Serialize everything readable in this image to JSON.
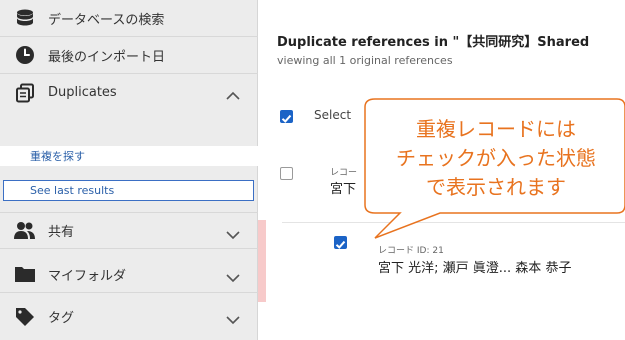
{
  "sidebar": {
    "items": [
      {
        "label": "データベースの検索",
        "icon": "database-icon"
      },
      {
        "label": "最後のインポート日",
        "icon": "clock-icon"
      },
      {
        "label": "Duplicates",
        "icon": "duplicates-icon"
      },
      {
        "label": "共有",
        "icon": "users-icon"
      },
      {
        "label": "マイフォルダ",
        "icon": "folder-icon"
      },
      {
        "label": "タグ",
        "icon": "tag-icon"
      }
    ],
    "sub_items": [
      {
        "label": "重複を探す"
      },
      {
        "label": "See last results"
      }
    ]
  },
  "main": {
    "title": "Duplicate references in \"【共同研究】Shared",
    "subtitle": "viewing all 1 original references",
    "select_label": "Select",
    "rows": [
      {
        "meta": "レコー",
        "authors": "宮下",
        "checked": false
      },
      {
        "meta": "レコード ID: 21",
        "authors": "宮下 光洋; 瀬戸 眞澄... 森本 恭子",
        "checked": true
      }
    ]
  },
  "callout": {
    "lines": [
      "重複レコードには",
      "チェックが入った状態",
      "で表示されます"
    ],
    "stroke_color": "#e8731f",
    "text_color": "#e8731f"
  },
  "colors": {
    "accent": "#1b63c6",
    "link": "#2a5fa8",
    "highlight": "#f7caca"
  }
}
